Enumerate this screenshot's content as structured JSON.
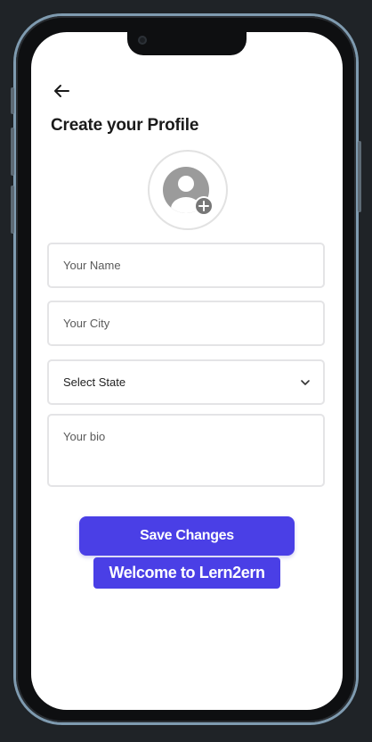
{
  "header": {
    "back_icon": "arrow-left-icon",
    "title": "Create your Profile"
  },
  "avatar": {
    "icon": "user-placeholder-icon",
    "badge_icon": "plus-circle-icon"
  },
  "form": {
    "name_placeholder": "Your Name",
    "city_placeholder": "Your City",
    "state_selected": "Select State",
    "state_icon": "chevron-down-icon",
    "bio_placeholder": "Your bio"
  },
  "actions": {
    "save_label": "Save Changes",
    "welcome_text": "Welcome to Lern2ern"
  },
  "colors": {
    "primary": "#4a3fe6",
    "background": "#1f2327",
    "field_border": "#e4e4e6"
  }
}
